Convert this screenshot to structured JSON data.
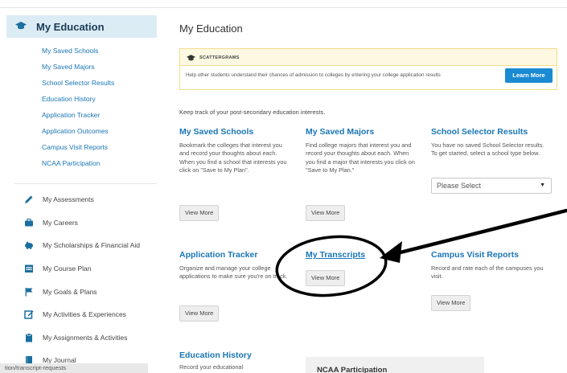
{
  "sidebar": {
    "header": {
      "title": "My Education",
      "icon": "graduation-cap-icon"
    },
    "sub_items": [
      "My Saved Schools",
      "My Saved Majors",
      "School Selector Results",
      "Education History",
      "Application Tracker",
      "Application Outcomes",
      "Campus Visit Reports",
      "NCAA Participation"
    ],
    "nav_items": [
      {
        "label": "My Assessments",
        "icon": "pencil-icon"
      },
      {
        "label": "My Careers",
        "icon": "briefcase-icon"
      },
      {
        "label": "My Scholarships & Financial Aid",
        "icon": "piggy-bank-icon"
      },
      {
        "label": "My Course Plan",
        "icon": "calendar-icon"
      },
      {
        "label": "My Goals & Plans",
        "icon": "flag-icon"
      },
      {
        "label": "My Activities & Experiences",
        "icon": "edit-square-icon"
      },
      {
        "label": "My Assignments & Activities",
        "icon": "clipboard-icon"
      },
      {
        "label": "My Journal",
        "icon": "book-icon"
      }
    ],
    "status_url": "tion/transcript-requests"
  },
  "main": {
    "title": "My Education",
    "scattergrams": {
      "label": "SCATTERGRAMS",
      "text": "Help other students understand their chances of admission to colleges by entering your college application results",
      "button": "Learn More"
    },
    "intro": "Keep track of your post-secondary education interests.",
    "cards": {
      "saved_schools": {
        "title": "My Saved Schools",
        "desc": "Bookmark the colleges that interest you and record your thoughts about each. When you find a school that interests you click on \"Save to My Plan\".",
        "button": "View More"
      },
      "saved_majors": {
        "title": "My Saved Majors",
        "desc": "Find college majors that interest you and record your thoughts about each. When you find a major that interests you click on \"Save to My Plan.\"",
        "button": "View More"
      },
      "school_selector": {
        "title": "School Selector Results",
        "desc": "You have no saved School Selector results. To get started, select a school type below.",
        "select_value": "Please Select"
      },
      "application_tracker": {
        "title": "Application Tracker",
        "desc": "Organize and manage your college applications to make sure you're on track.",
        "button": "View More"
      },
      "transcripts": {
        "title": "My Transcripts",
        "button": "View More"
      },
      "campus_visits": {
        "title": "Campus Visit Reports",
        "desc": "Record and rate each of the campuses you visit.",
        "button": "View More"
      },
      "education_history": {
        "title": "Education History",
        "desc": "Record your educational"
      },
      "ncaa": {
        "title": "NCAA Participation"
      }
    }
  },
  "colors": {
    "accent": "#1a76b6",
    "button": "#1a8ad2",
    "banner": "#fdf8e2",
    "header_bg": "#dcecf5"
  }
}
